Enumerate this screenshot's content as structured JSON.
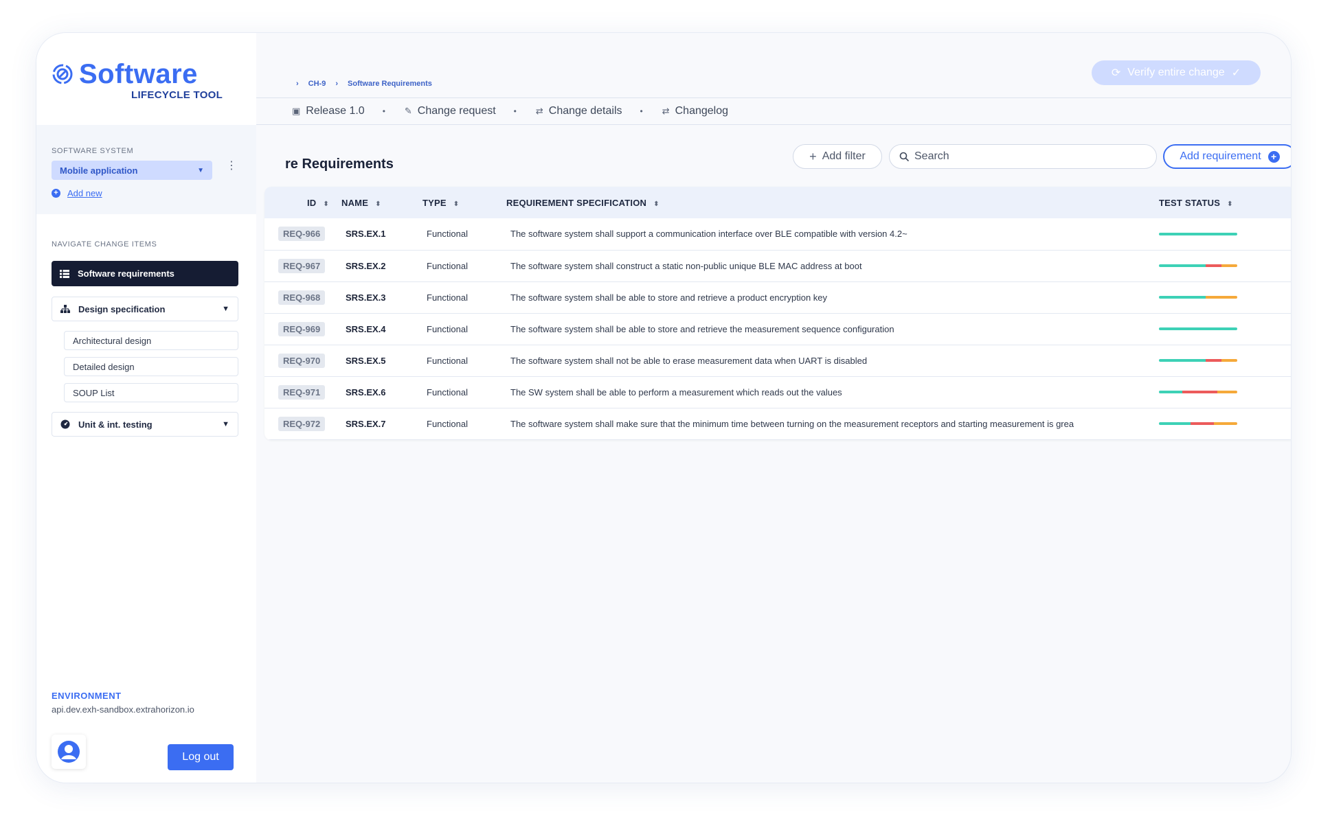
{
  "breadcrumb": {
    "items": [
      "CH-9",
      "Software Requirements"
    ]
  },
  "header": {
    "verify_label": "Verify entire change"
  },
  "tabs": [
    {
      "label": "Release 1.0",
      "icon": "package-icon"
    },
    {
      "label": "Change request",
      "icon": "edit-icon"
    },
    {
      "label": "Change details",
      "icon": "swap-icon"
    },
    {
      "label": "Changelog",
      "icon": "swap-icon"
    }
  ],
  "page": {
    "title": "re Requirements"
  },
  "toolbar": {
    "add_filter_label": "Add filter",
    "search_placeholder": "Search",
    "add_requirement_label": "Add requirement"
  },
  "table": {
    "columns": [
      "ID",
      "NAME",
      "TYPE",
      "REQUIREMENT SPECIFICATION",
      "TEST STATUS"
    ],
    "rows": [
      {
        "id": "REQ-966",
        "name": "SRS.EX.1",
        "type": "Functional",
        "spec": "The software system shall support a communication interface over BLE compatible with version 4.2~",
        "status": {
          "pass": 1.0,
          "fail": 0,
          "pending": 0
        }
      },
      {
        "id": "REQ-967",
        "name": "SRS.EX.2",
        "type": "Functional",
        "spec": "The software system shall construct a static non-public unique BLE MAC address at boot",
        "status": {
          "pass": 0.6,
          "fail": 0.2,
          "pending": 0.2
        }
      },
      {
        "id": "REQ-968",
        "name": "SRS.EX.3",
        "type": "Functional",
        "spec": "The software system shall be able to store and retrieve a product encryption key",
        "status": {
          "pass": 0.6,
          "fail": 0,
          "pending": 0.4
        }
      },
      {
        "id": "REQ-969",
        "name": "SRS.EX.4",
        "type": "Functional",
        "spec": "The software system shall be able to store and retrieve the measurement sequence configuration",
        "status": {
          "pass": 1.0,
          "fail": 0,
          "pending": 0
        }
      },
      {
        "id": "REQ-970",
        "name": "SRS.EX.5",
        "type": "Functional",
        "spec": "The software system shall not be able to erase measurement data when UART is disabled",
        "status": {
          "pass": 0.6,
          "fail": 0.2,
          "pending": 0.2
        }
      },
      {
        "id": "REQ-971",
        "name": "SRS.EX.6",
        "type": "Functional",
        "spec": "The SW system shall be able to perform a measurement which reads out the values",
        "status": {
          "pass": 0.3,
          "fail": 0.45,
          "pending": 0.25
        }
      },
      {
        "id": "REQ-972",
        "name": "SRS.EX.7",
        "type": "Functional",
        "spec": "The software system shall make sure that the minimum time between turning on the measurement receptors and starting measurement is grea",
        "status": {
          "pass": 0.4,
          "fail": 0.3,
          "pending": 0.3
        }
      }
    ]
  },
  "colors": {
    "accent": "#3b6df2",
    "pass": "#3dd1b6",
    "fail": "#ec5b5b",
    "pending": "#f5a93a",
    "nav_active": "#151c33"
  },
  "sidebar": {
    "logo_word": "Software",
    "logo_sub": "LIFECYCLE TOOL",
    "system_label": "SOFTWARE SYSTEM",
    "system_value": "Mobile application",
    "add_new_label": "Add new",
    "nav_label": "NAVIGATE CHANGE ITEMS",
    "nav_active": "Software requirements",
    "design_group": "Design specification",
    "design_items": [
      "Architectural design",
      "Detailed design",
      "SOUP List"
    ],
    "testing_group": "Unit & int. testing",
    "env_label": "ENVIRONMENT",
    "env_value": "api.dev.exh-sandbox.extrahorizon.io",
    "logout_label": "Log out"
  }
}
